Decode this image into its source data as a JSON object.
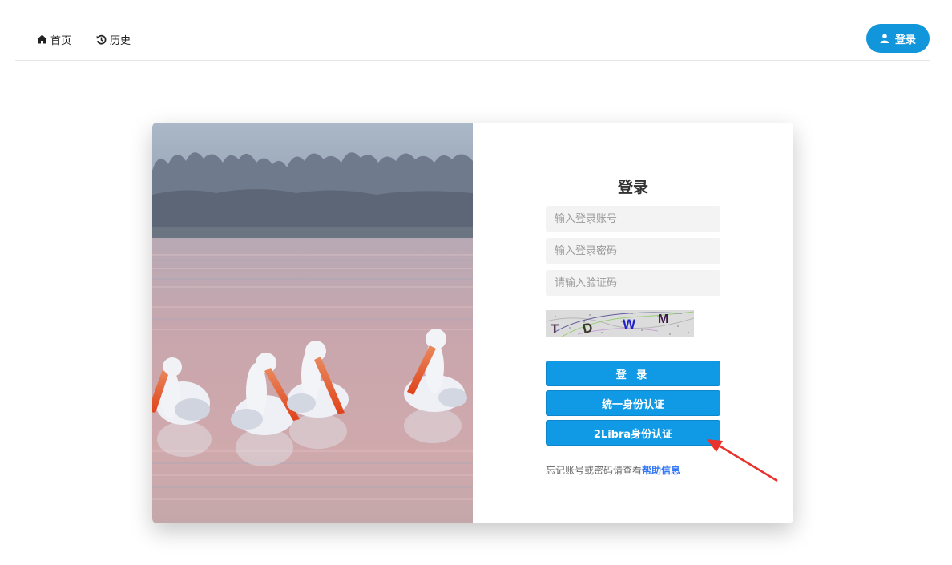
{
  "nav": {
    "home": "首页",
    "history": "历史",
    "login": "登录"
  },
  "login_form": {
    "title": "登录",
    "account_placeholder": "输入登录账号",
    "password_placeholder": "输入登录密码",
    "captcha_placeholder": "请输入验证码",
    "captcha_text": [
      "T",
      "D",
      "W",
      "M"
    ],
    "login_button": "登 录",
    "unified_auth_button": "统一身份认证",
    "libra_auth_button": "2Libra身份认证",
    "help_prefix": "忘记账号或密码请查看",
    "help_link": "帮助信息"
  },
  "colors": {
    "primary": "#109ae6",
    "annotation_arrow": "#e8322b",
    "link": "#3478f6"
  },
  "icons": {
    "home": "home-icon",
    "history": "history-icon",
    "user": "user-icon"
  }
}
